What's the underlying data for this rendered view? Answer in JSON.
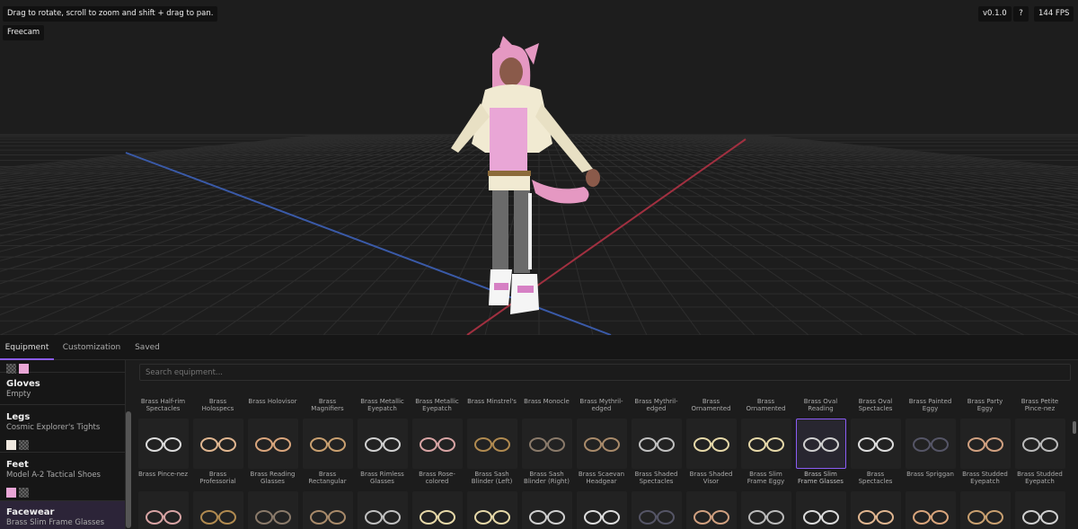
{
  "viewport": {
    "hint": "Drag to rotate, scroll to zoom and shift + drag to pan.",
    "freecam_label": "Freecam",
    "version": "v0.1.0",
    "help_label": "?",
    "fps": "144 FPS"
  },
  "tabs": [
    {
      "label": "Equipment",
      "active": true
    },
    {
      "label": "Customization",
      "active": false
    },
    {
      "label": "Saved",
      "active": false
    }
  ],
  "sidebar": {
    "slots": [
      {
        "name": "Gloves",
        "value": "Empty",
        "swatches": []
      },
      {
        "name": "Legs",
        "value": "Cosmic Explorer's Tights",
        "swatches": [
          "#efe8df",
          "checker"
        ]
      },
      {
        "name": "Feet",
        "value": "Model A-2 Tactical Shoes",
        "swatches": [
          "#e9a6d6",
          "checker"
        ]
      },
      {
        "name": "Facewear",
        "value": "Brass Slim Frame Glasses",
        "swatches": [],
        "active": true
      }
    ]
  },
  "search": {
    "placeholder": "Search equipment..."
  },
  "items": {
    "row1_labels": [
      "Brass Half-rim Spectacles",
      "Brass Holospecs",
      "Brass Holovisor",
      "Brass Magnifiers",
      "Brass Metallic Eyepatch",
      "Brass Metallic Eyepatch",
      "Brass Minstrel's",
      "Brass Monocle",
      "Brass Mythril-edged",
      "Brass Mythril-edged",
      "Brass Ornamented",
      "Brass Ornamented",
      "Brass Oval Reading",
      "Brass Oval Spectacles",
      "Brass Painted Eggy",
      "Brass Party Eggy",
      "Brass Petite Pince-nez"
    ],
    "row2_labels": [
      "Brass Pince-nez",
      "Brass Professorial",
      "Brass Reading Glasses",
      "Brass Rectangular",
      "Brass Rimless Glasses",
      "Brass Rose-colored",
      "Brass Sash Blinder (Left)",
      "Brass Sash Blinder (Right)",
      "Brass Scaevan Headgear",
      "Brass Shaded Spectacles",
      "Brass Shaded Visor",
      "Brass Slim Frame Eggy",
      "Brass Slim Frame Glasses",
      "Brass Spectacles",
      "Brass Spriggan",
      "Brass Studded Eyepatch",
      "Brass Studded Eyepatch"
    ],
    "selected": "Brass Slim Frame Glasses"
  },
  "colors": {
    "accent": "#8b5cf6",
    "x_axis": "#a13040",
    "z_axis": "#3a5aa8"
  }
}
